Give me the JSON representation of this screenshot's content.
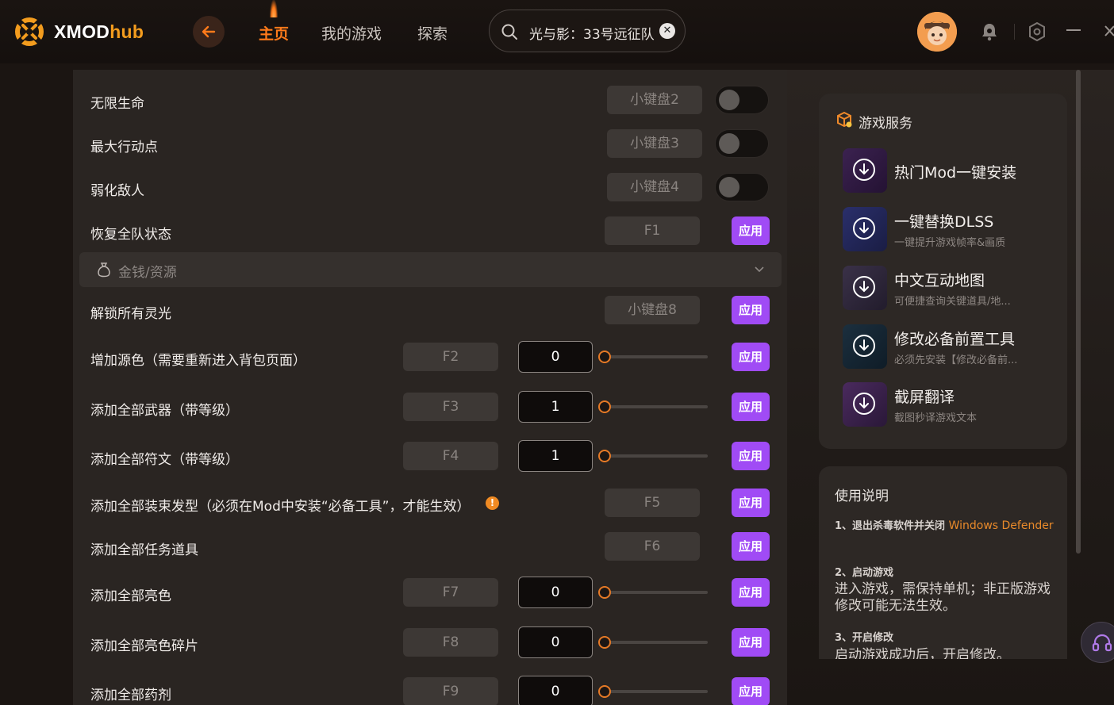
{
  "header": {
    "brand_main": "XMOD",
    "brand_accent": "hub",
    "nav": [
      "主页",
      "我的游戏",
      "探索"
    ],
    "search_value": "光与影：33号远征队",
    "accent_color": "#ff7a1a"
  },
  "mods": [
    {
      "label": "无限生命",
      "key": "小键盘2",
      "control": "toggle",
      "state": "off"
    },
    {
      "label": "最大行动点",
      "key": "小键盘3",
      "control": "toggle",
      "state": "off"
    },
    {
      "label": "弱化敌人",
      "key": "小键盘4",
      "control": "toggle",
      "state": "off"
    },
    {
      "label": "恢复全队状态",
      "key": "F1",
      "control": "apply",
      "apply": "应用"
    }
  ],
  "section": {
    "label": "金钱/资源",
    "icon": "money-bag-icon"
  },
  "items": [
    {
      "label": "解锁所有灵光",
      "key": "小键盘8",
      "apply": "应用"
    },
    {
      "label": "增加源色（需要重新进入背包页面）",
      "key": "F2",
      "value": "0",
      "apply": "应用"
    },
    {
      "label": "添加全部武器（带等级）",
      "key": "F3",
      "value": "1",
      "apply": "应用"
    },
    {
      "label": "添加全部符文（带等级）",
      "key": "F4",
      "value": "1",
      "apply": "应用"
    },
    {
      "label": "添加全部装束发型（必须在Mod中安装“必备工具”，才能生效）",
      "key": "F5",
      "apply": "应用",
      "info": "!"
    },
    {
      "label": "添加全部任务道具",
      "key": "F6",
      "apply": "应用"
    },
    {
      "label": "添加全部亮色",
      "key": "F7",
      "value": "0",
      "apply": "应用"
    },
    {
      "label": "添加全部亮色碎片",
      "key": "F8",
      "value": "0",
      "apply": "应用"
    },
    {
      "label": "添加全部药剂",
      "key": "F9",
      "value": "0",
      "apply": "应用"
    }
  ],
  "services": {
    "title": "游戏服务",
    "items": [
      {
        "name": "热门Mod一键安装",
        "desc": ""
      },
      {
        "name": "一键替换DLSS",
        "desc": "一键提升游戏帧率&画质"
      },
      {
        "name": "中文互动地图",
        "desc": "可便捷查询关键道具/地..."
      },
      {
        "name": "修改必备前置工具",
        "desc": "必须先安装【修改必备前..."
      },
      {
        "name": "截屏翻译",
        "desc": "截图秒译游戏文本"
      }
    ]
  },
  "help": {
    "title": "使用说明",
    "step1": "1、退出杀毒软件并关闭",
    "step1_highlight": "Windows Defender",
    "step2": "2、启动游戏",
    "step2_body": "进入游戏，需保持单机；非正版游戏修改可能无法生效。",
    "step3": "3、开启修改",
    "step3_body": "启动游戏成功后，开启修改。"
  }
}
